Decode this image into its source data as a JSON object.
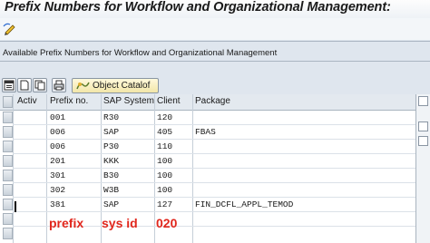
{
  "page_title": "Prefix Numbers for Workflow and Organizational Management:",
  "frame_title": "Available Prefix Numbers for Workflow and Organizational Management",
  "toolbar": {
    "edit_icon": "edit-pencil-icon",
    "object_catalog_label": "Object Catalof"
  },
  "table": {
    "columns": [
      "Activ",
      "Prefix no.",
      "SAP System",
      "Client",
      "Package"
    ],
    "rows": [
      {
        "activ": "",
        "prefix": "001",
        "system": "R30",
        "client": "120",
        "package": ""
      },
      {
        "activ": "",
        "prefix": "006",
        "system": "SAP",
        "client": "405",
        "package": "FBAS"
      },
      {
        "activ": "",
        "prefix": "006",
        "system": "P30",
        "client": "110",
        "package": ""
      },
      {
        "activ": "",
        "prefix": "201",
        "system": "KKK",
        "client": "100",
        "package": ""
      },
      {
        "activ": "",
        "prefix": "301",
        "system": "B30",
        "client": "100",
        "package": ""
      },
      {
        "activ": "",
        "prefix": "302",
        "system": "W3B",
        "client": "100",
        "package": ""
      },
      {
        "activ": "",
        "prefix": "381",
        "system": "SAP",
        "client": "127",
        "package": "FIN_DCFL_APPL_TEMOD"
      }
    ]
  },
  "annotations": {
    "prefix": "prefix",
    "sys_id": "sys id",
    "client": "020"
  }
}
